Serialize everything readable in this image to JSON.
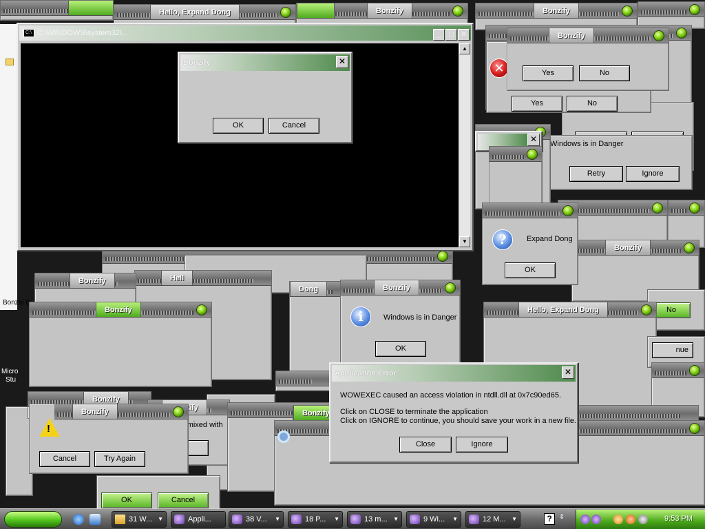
{
  "colors": {
    "accent_green": "#58b526",
    "chrome_gray": "#c4c4c4",
    "title_gradient_end": "#4f8a4c",
    "console_bg": "#000000"
  },
  "console": {
    "title": "C:\\WINDOWS\\system32\\..."
  },
  "dialogs": {
    "bonzify_top_center": {
      "title": "Bonzify",
      "ok": "OK",
      "cancel": "Cancel"
    },
    "app_error": {
      "title": "Application Error",
      "line1": "WOWEXEC caused an access violation in ntdll.dll at 0x7c90ed65.",
      "line2": "Click on CLOSE to terminate the application",
      "line3": "Click on IGNORE to continue, you should save your work in a new file.",
      "close": "Close",
      "ignore": "Ignore"
    },
    "danger_center": {
      "title": "Bonzify",
      "message": "Windows is in Danger",
      "ok": "OK"
    },
    "expand_dong_mid": {
      "message": "Expand Dong",
      "ok": "OK"
    },
    "retry_dialog": {
      "message": "Windows is in Danger",
      "retry": "Retry",
      "ignore": "Ignore"
    },
    "yesno_top": {
      "title": "Bonzify",
      "yes": "Yes",
      "no": "No"
    },
    "yesno_lower": {
      "yes": "Yes",
      "no": "No"
    },
    "okcancel_right": {
      "ok": "OK",
      "cancel": "Cancel"
    },
    "warn_bottom": {
      "title": "Bonzify",
      "cancel": "Cancel",
      "try_again": "Try Again"
    },
    "lemon": {
      "title": "Bonzify",
      "message": "Lemon mixed with",
      "ok": "OK"
    },
    "bottom_greens": {
      "ok": "OK",
      "cancel": "Cancel"
    },
    "no_right": {
      "no": "No"
    },
    "continue_partial": {
      "label": "nue"
    }
  },
  "titles": {
    "hello_top": "Hello, Expand Dong",
    "hello_right": "Hello, Expand Dong",
    "bonzify": "Bonzify",
    "hello_partial": "Hell",
    "dong_partial": "Dong"
  },
  "desktop": {
    "bonzai_label": "Bonzai B",
    "micro_label": "Micro",
    "stu_label": "Stu"
  },
  "taskbar": {
    "buttons": [
      {
        "label": "31 W...",
        "icon": "folder-icon"
      },
      {
        "label": "Appli...",
        "icon": "bonzi-icon"
      },
      {
        "label": "38 V...",
        "icon": "bonzi-icon"
      },
      {
        "label": "18 P...",
        "icon": "bonzi-icon"
      },
      {
        "label": "13 m...",
        "icon": "bonzi-icon"
      },
      {
        "label": "9 Wi...",
        "icon": "bonzi-icon"
      },
      {
        "label": "12 M...",
        "icon": "bonzi-icon"
      }
    ],
    "clock": "9:53 PM"
  }
}
